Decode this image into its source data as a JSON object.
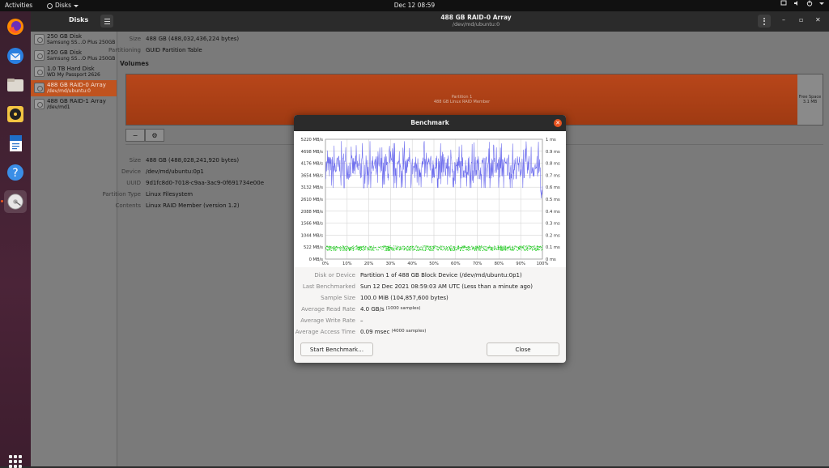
{
  "topbar": {
    "activities": "Activities",
    "app_name": "Disks",
    "clock": "Dec 12  08:59"
  },
  "dock": {
    "items": [
      "firefox-icon",
      "thunderbird-icon",
      "files-icon",
      "rhythmbox-icon",
      "writer-icon",
      "help-icon",
      "disks-icon"
    ]
  },
  "window": {
    "sidebar_title": "Disks",
    "title": "488 GB RAID-0 Array",
    "subtitle": "/dev/md/ubuntu:0"
  },
  "sidebar": {
    "disks": [
      {
        "name": "250 GB Disk",
        "sub": "Samsung SS…O Plus 250GB"
      },
      {
        "name": "250 GB Disk",
        "sub": "Samsung SS…O Plus 250GB"
      },
      {
        "name": "1.0 TB Hard Disk",
        "sub": "WD My Passport 2626"
      },
      {
        "name": "488 GB RAID-0 Array",
        "sub": "/dev/md/ubuntu:0"
      },
      {
        "name": "488 GB RAID-1 Array",
        "sub": "/dev/md1"
      }
    ]
  },
  "drive": {
    "size_label": "Size",
    "size": "488 GB (488,032,436,224 bytes)",
    "partitioning_label": "Partitioning",
    "partitioning": "GUID Partition Table",
    "volumes_title": "Volumes",
    "partition_line1": "Partition 1",
    "partition_line2": "488 GB Linux RAID Member",
    "free_line1": "Free Space",
    "free_line2": "3.1 MB"
  },
  "volume": {
    "rows": [
      {
        "k": "Size",
        "v": "488 GB (488,028,241,920 bytes)"
      },
      {
        "k": "Device",
        "v": "/dev/md/ubuntu:0p1"
      },
      {
        "k": "UUID",
        "v": "9d1fc8d0-7018-c9aa-3ac9-0f691734e00e"
      },
      {
        "k": "Partition Type",
        "v": "Linux Filesystem"
      },
      {
        "k": "Contents",
        "v": "Linux RAID Member (version 1.2)"
      }
    ]
  },
  "dialog": {
    "title": "Benchmark",
    "disk_label": "Disk or Device",
    "disk": "Partition 1 of 488 GB Block Device (/dev/md/ubuntu:0p1)",
    "last_label": "Last Benchmarked",
    "last": "Sun 12 Dec 2021 08:59:03 AM UTC (Less than a minute ago)",
    "sample_label": "Sample Size",
    "sample": "100.0 MiB (104,857,600 bytes)",
    "read_label": "Average Read Rate",
    "read": "4.0 GB/s",
    "read_note": "(1000 samples)",
    "write_label": "Average Write Rate",
    "write": "–",
    "access_label": "Average Access Time",
    "access": "0.09 msec",
    "access_note": "(4000 samples)",
    "start_button": "Start Benchmark…",
    "close_button": "Close"
  },
  "chart_data": {
    "type": "line",
    "x_ticks": [
      "0%",
      "10%",
      "20%",
      "30%",
      "40%",
      "50%",
      "60%",
      "70%",
      "80%",
      "90%",
      "100%"
    ],
    "y_left_ticks": [
      "0 MB/s",
      "522 MB/s",
      "1044 MB/s",
      "1566 MB/s",
      "2088 MB/s",
      "2610 MB/s",
      "3132 MB/s",
      "3654 MB/s",
      "4176 MB/s",
      "4698 MB/s",
      "5220 MB/s"
    ],
    "y_right_ticks": [
      "0 ms",
      "0.1 ms",
      "0.2 ms",
      "0.3 ms",
      "0.4 ms",
      "0.5 ms",
      "0.6 ms",
      "0.7 ms",
      "0.8 ms",
      "0.9 ms",
      "1 ms"
    ],
    "ylim_left": [
      0,
      5220
    ],
    "ylim_right": [
      0,
      1
    ],
    "xlim": [
      0,
      100
    ],
    "series": [
      {
        "color": "#7070ee",
        "mean": 4000,
        "min": 3100,
        "max": 5150
      },
      {
        "color": "#22cc22",
        "mean": 0.09,
        "min": 0.07,
        "max": 0.11
      }
    ],
    "grid": true
  }
}
